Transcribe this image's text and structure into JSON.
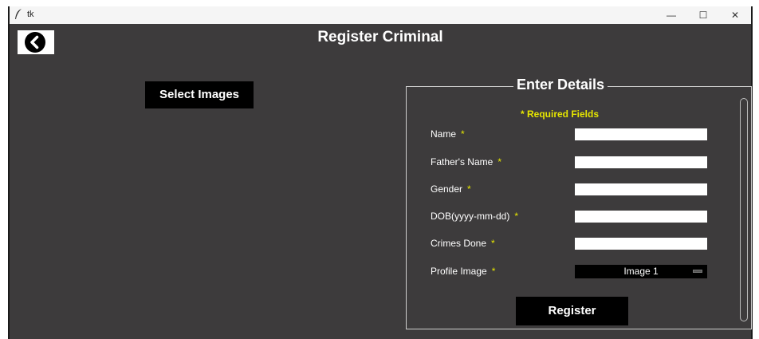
{
  "window": {
    "title": "tk",
    "controls": {
      "minimize": "—",
      "maximize": "☐",
      "close": "✕"
    }
  },
  "page": {
    "title": "Register Criminal",
    "back_icon": "chevron-left-circle-icon"
  },
  "left": {
    "select_images_label": "Select Images"
  },
  "form": {
    "legend": "Enter Details",
    "required_note": "* Required Fields",
    "fields": [
      {
        "label": "Name",
        "value": ""
      },
      {
        "label": "Father's Name",
        "value": ""
      },
      {
        "label": "Gender",
        "value": ""
      },
      {
        "label": "DOB(yyyy-mm-dd)",
        "value": ""
      },
      {
        "label": "Crimes Done",
        "value": ""
      }
    ],
    "profile_image": {
      "label": "Profile Image",
      "selected": "Image 1"
    },
    "required_star": "*",
    "register_label": "Register"
  },
  "colors": {
    "background": "#3d3b3c",
    "required_yellow": "#e6e600",
    "button_black": "#000000"
  }
}
